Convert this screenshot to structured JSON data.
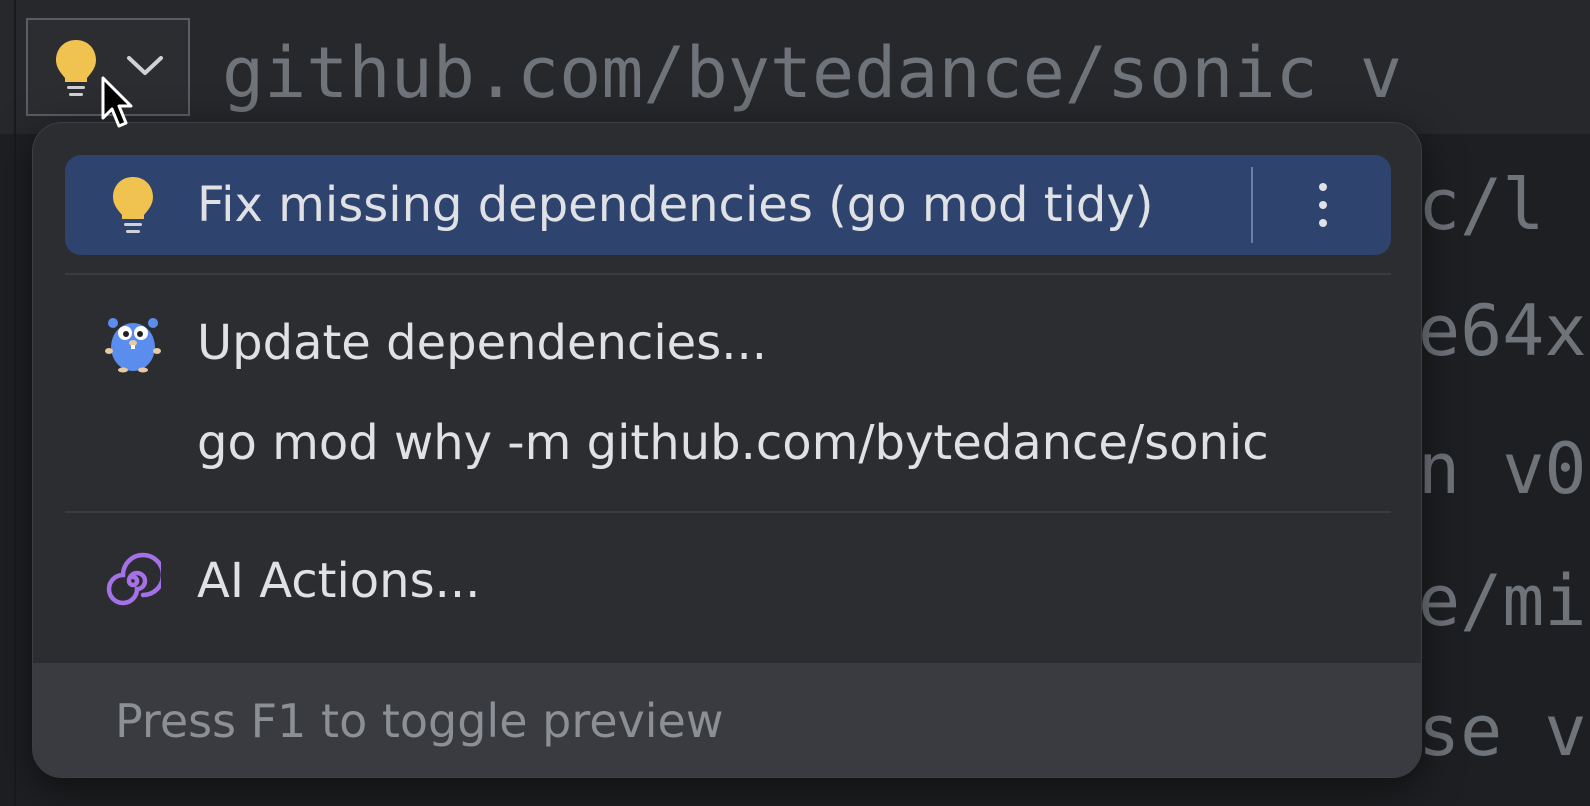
{
  "editor": {
    "line1": "github.com/bytedance/sonic v",
    "line2_tail": "c/l",
    "line3_tail": "e64x",
    "line4_tail": "n v0",
    "line5_tail": "e/mi",
    "line6_tail": "se v"
  },
  "intention_button": {
    "icon": "lightbulb-icon",
    "dropdown_icon": "chevron-down-icon"
  },
  "popup": {
    "items": [
      {
        "label": "Fix missing dependencies (go mod tidy)",
        "icon": "lightbulb-icon",
        "selected": true
      },
      {
        "label": "Update dependencies...",
        "icon": "gopher-icon",
        "selected": false
      },
      {
        "label": "go mod why -m github.com/bytedance/sonic",
        "icon": "",
        "selected": false
      },
      {
        "label": "AI Actions...",
        "icon": "ai-spiral-icon",
        "selected": false
      }
    ],
    "footer_hint": "Press F1 to toggle preview"
  },
  "colors": {
    "background": "#1e1f22",
    "popup": "#2b2d30",
    "selection": "#2e436e",
    "bulb": "#f0c24f",
    "ai_purple": "#a571e6",
    "gopher": "#5b8def"
  }
}
